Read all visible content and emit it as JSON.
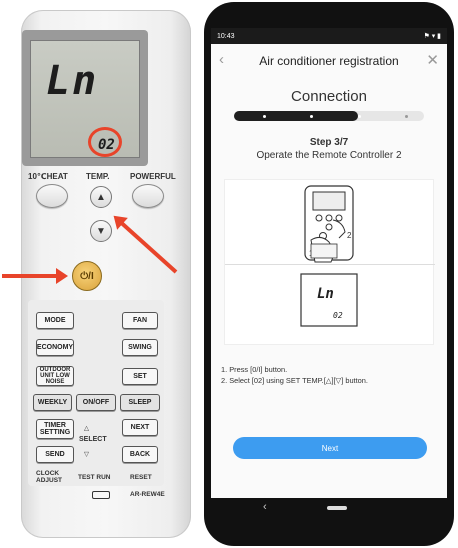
{
  "remote": {
    "lcd_main": "Ln",
    "lcd_code": "02",
    "labels": {
      "heat": "10℃HEAT",
      "temp": "TEMP.",
      "powerful": "POWERFUL"
    },
    "power_symbol": "⏻/I",
    "keys": {
      "mode": "MODE",
      "fan": "FAN",
      "economy": "ECONOMY",
      "swing": "SWING",
      "outdoor": "OUTDOOR UNIT LOW NOISE",
      "set": "SET",
      "weekly": "WEEKLY",
      "onoff": "ON/OFF",
      "sleep": "SLEEP",
      "timer": "TIMER SETTING",
      "next": "NEXT",
      "select": "SELECT",
      "send": "SEND",
      "back": "BACK",
      "clock": "CLOCK ADJUST",
      "test_run": "TEST RUN",
      "reset": "RESET"
    },
    "model": "AR-REW4E",
    "accent_color": "#e8442a"
  },
  "phone": {
    "status_time": "10:43",
    "app_title": "Air conditioner registration",
    "section_title": "Connection",
    "progress": {
      "current_step": 3,
      "total_steps": 7,
      "dots_total": 4,
      "dots_done": 3
    },
    "step_label": "Step 3/7",
    "step_desc": "Operate the Remote Controller 2",
    "illus_lcd": "Ln",
    "illus_code": "02",
    "instructions": [
      "1. Press [0/I] button.",
      "2. Select [02] using SET TEMP.[△][▽] button."
    ],
    "next_label": "Next",
    "accent_color": "#3d9cf0"
  }
}
